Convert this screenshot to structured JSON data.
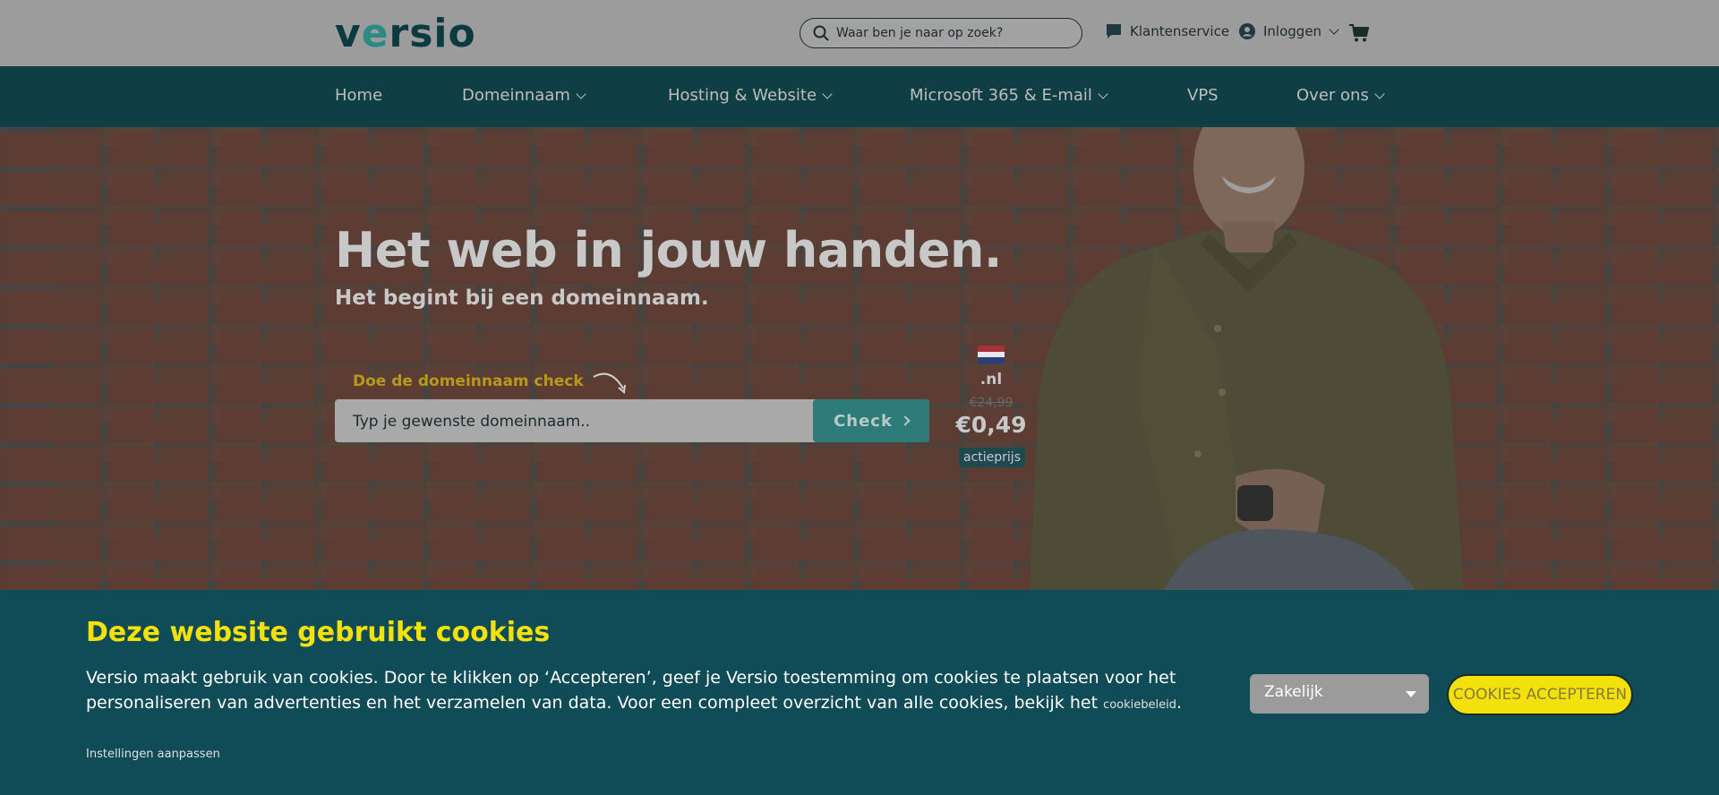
{
  "header": {
    "logo": "versio",
    "search_placeholder": "Waar ben je naar op zoek?",
    "customer_service": "Klantenservice",
    "login": "Inloggen"
  },
  "nav": {
    "items": [
      {
        "label": "Home"
      },
      {
        "label": "Domeinnaam"
      },
      {
        "label": "Hosting & Website"
      },
      {
        "label": "Microsoft 365 & E-mail"
      },
      {
        "label": "VPS"
      },
      {
        "label": "Over ons"
      }
    ]
  },
  "hero": {
    "title": "Het web in jouw handen.",
    "subtitle": "Het begint bij een domeinnaam.",
    "check_label": "Doe de domeinnaam check",
    "domain_placeholder": "Typ je gewenste domeinnaam..",
    "check_button": "Check",
    "tld": ".nl",
    "old_price": "€24,99",
    "price": "€0,49",
    "price_badge": "actieprijs"
  },
  "cookie": {
    "title": "Deze website gebruikt cookies",
    "text": "Versio maakt gebruik van cookies. Door te klikken op ‘Accepteren’, geef je Versio toestemming om cookies te plaatsen voor het personaliseren van advertenties en het verzamelen van data. Voor een compleet overzicht van alle cookies, bekijk het",
    "link": "cookiebeleid",
    "period": ".",
    "settings": "Instellingen aanpassen",
    "select_value": "Zakelijk",
    "accept_button": "COOKIES ACCEPTEREN"
  },
  "colors": {
    "brand_dark": "#0f3f44",
    "brand_teal": "#2d7c7a",
    "cookie_bg": "#0f4c57",
    "accent_yellow": "#f2e10a"
  }
}
